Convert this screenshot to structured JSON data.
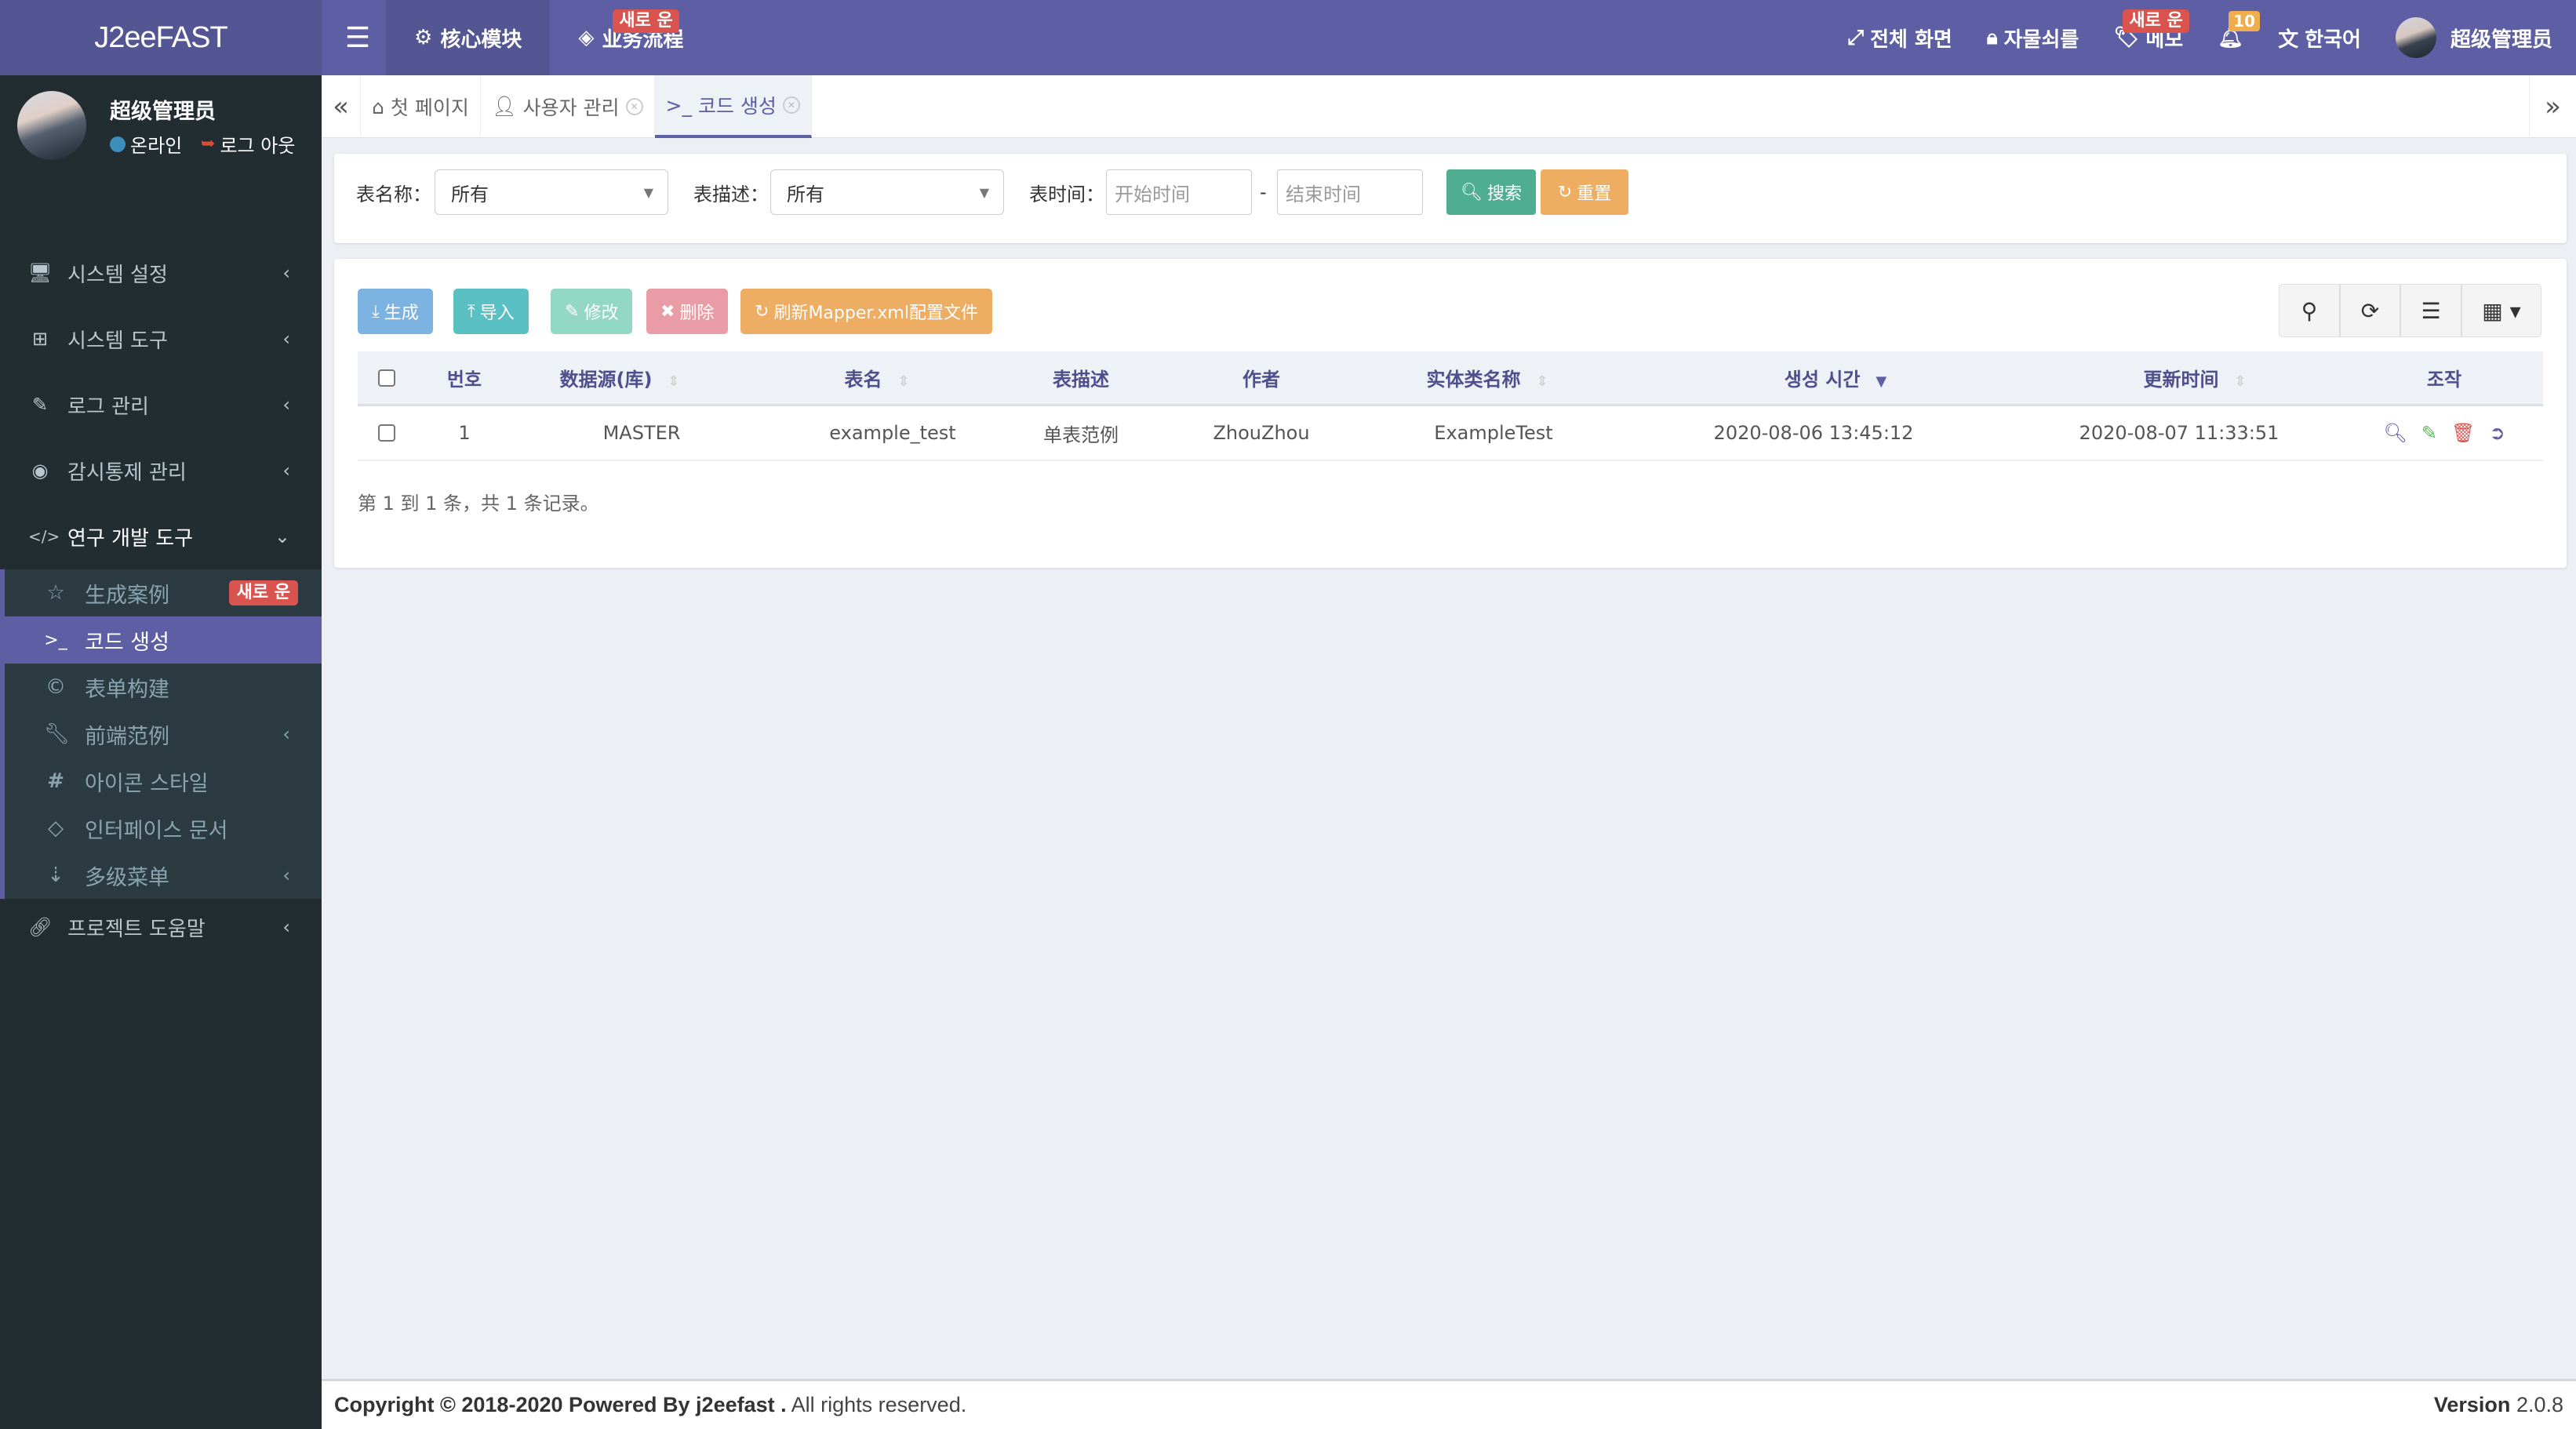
{
  "header": {
    "logo": "J2eeFAST",
    "modules": [
      {
        "label": "核心模块",
        "icon": "gear-icon",
        "active": true
      },
      {
        "label": "业务流程",
        "icon": "codepen-icon",
        "badge": "새로 운"
      }
    ],
    "right": {
      "fullscreen": "전체 화면",
      "lock": "자물쇠를",
      "memo": "메모",
      "memo_badge": "새로 운",
      "notification_count": "10",
      "language": "한국어",
      "username": "超级管理员"
    }
  },
  "sidebar": {
    "user": {
      "name": "超级管理员",
      "status": "온라인",
      "logout": "로그 아웃"
    },
    "menu": [
      {
        "label": "시스템 설정",
        "icon": "desktop-icon"
      },
      {
        "label": "시스템 도구",
        "icon": "windows-icon"
      },
      {
        "label": "로그 관리",
        "icon": "edit-icon"
      },
      {
        "label": "감시통제 관리",
        "icon": "eye-icon"
      },
      {
        "label": "연구 개발 도구",
        "icon": "code-icon",
        "open": true
      }
    ],
    "submenu": [
      {
        "label": "生成案例",
        "icon": "star-icon",
        "badge": "새로 운"
      },
      {
        "label": "코드 생성",
        "icon": "terminal-icon",
        "active": true
      },
      {
        "label": "表单构建",
        "icon": "copyright-icon"
      },
      {
        "label": "前端范例",
        "icon": "wrench-icon",
        "has_children": true
      },
      {
        "label": "아이콘 스타일",
        "icon": "hashtag-icon"
      },
      {
        "label": "인터페이스 문서",
        "icon": "gg-icon"
      },
      {
        "label": "多级菜单",
        "icon": "sort-amount-icon",
        "has_children": true
      }
    ],
    "after": [
      {
        "label": "프로젝트 도움말",
        "icon": "link-icon"
      }
    ]
  },
  "tabs": [
    {
      "label": "첫 페이지",
      "icon": "home-icon"
    },
    {
      "label": "사용자 관리",
      "icon": "user-icon",
      "closable": true
    },
    {
      "label": "코드 생성",
      "icon": "terminal-icon",
      "closable": true,
      "active": true
    }
  ],
  "search": {
    "table_name_label": "表名称：",
    "table_name_value": "所有",
    "table_desc_label": "表描述：",
    "table_desc_value": "所有",
    "time_label": "表时间：",
    "start_placeholder": "开始时间",
    "end_placeholder": "结束时间",
    "separator": "-",
    "search_btn": "搜索",
    "reset_btn": "重置"
  },
  "toolbar": {
    "generate": "生成",
    "import": "导入",
    "edit": "修改",
    "delete": "删除",
    "refresh_mapper": "刷新Mapper.xml配置文件"
  },
  "table": {
    "columns": [
      "번호",
      "数据源(库)",
      "表名",
      "表描述",
      "作者",
      "实体类名称",
      "생성 시간",
      "更新时间",
      "조작"
    ],
    "rows": [
      {
        "no": "1",
        "datasource": "MASTER",
        "table_name": "example_test",
        "table_desc": "单表范例",
        "author": "ZhouZhou",
        "entity": "ExampleTest",
        "created": "2020-08-06 13:45:12",
        "updated": "2020-08-07 11:33:51"
      }
    ],
    "pagination": "第 1 到 1 条，共 1 条记录。"
  },
  "footer": {
    "copyright_bold": "Copyright © 2018-2020 Powered By j2eefast .",
    "copyright_rest": " All rights reserved.",
    "version_label": "Version",
    "version": "2.0.8"
  },
  "colors": {
    "primary": "#5d5ea4",
    "sidebar_bg": "#222d32",
    "danger": "#d9534f",
    "warning": "#f0ad4e"
  }
}
